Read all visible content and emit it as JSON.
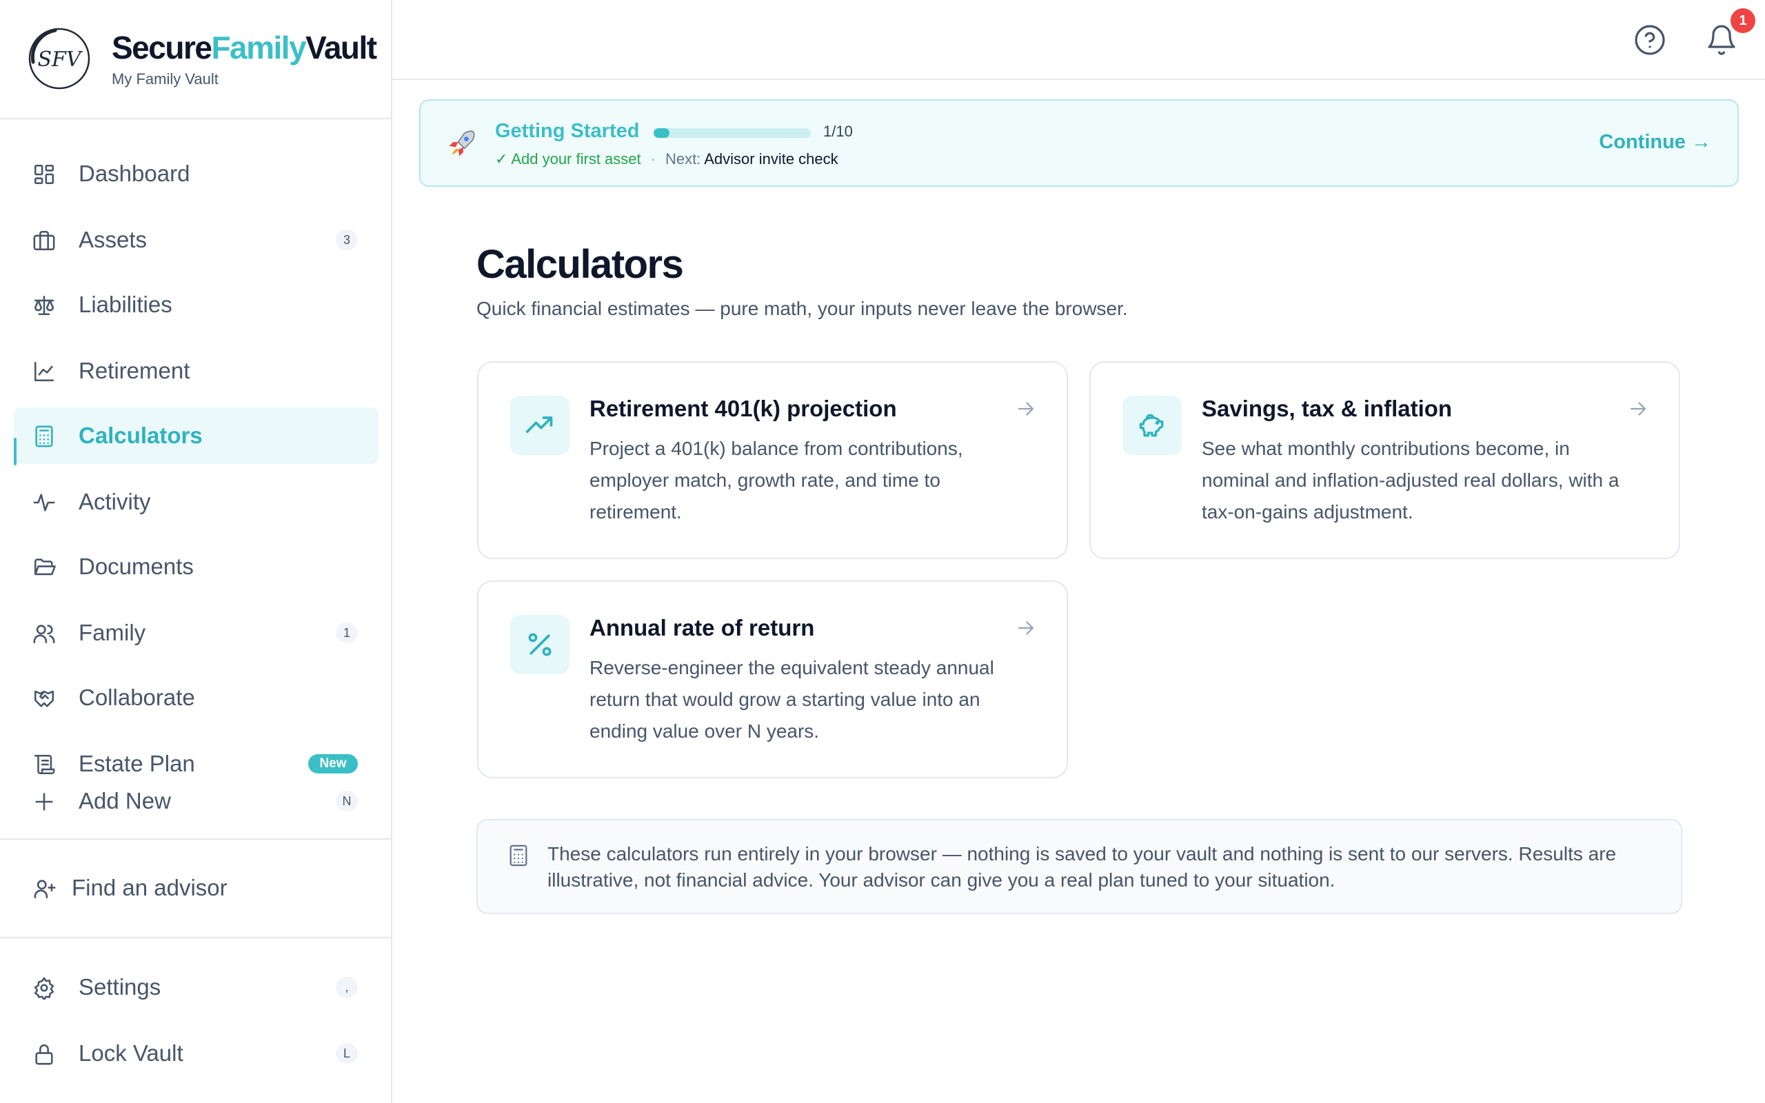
{
  "brand": {
    "logo_text": "SFV",
    "name_part1": "Secure",
    "name_part2": "Family",
    "name_part3": "Vault",
    "subtitle": "My Family Vault",
    "accent_color": "#3bbfc7"
  },
  "sidebar": {
    "items": [
      {
        "label": "Dashboard",
        "icon": "dashboard-icon"
      },
      {
        "label": "Assets",
        "icon": "briefcase-icon",
        "badge": "3"
      },
      {
        "label": "Liabilities",
        "icon": "scale-icon"
      },
      {
        "label": "Retirement",
        "icon": "line-chart-icon"
      },
      {
        "label": "Calculators",
        "icon": "calculator-icon",
        "active": true
      },
      {
        "label": "Activity",
        "icon": "activity-icon"
      },
      {
        "label": "Documents",
        "icon": "folder-open-icon"
      },
      {
        "label": "Family",
        "icon": "users-icon",
        "badge": "1"
      },
      {
        "label": "Collaborate",
        "icon": "handshake-icon"
      },
      {
        "label": "Estate Plan",
        "icon": "scroll-icon",
        "badge": "New"
      },
      {
        "label": "Add New",
        "icon": "plus-icon",
        "badge": "N"
      }
    ],
    "find_advisor": "Find an advisor",
    "settings": {
      "label": "Settings",
      "shortcut": ","
    },
    "lock": {
      "label": "Lock Vault",
      "shortcut": "L"
    }
  },
  "topbar": {
    "help_icon": "help-circle-icon",
    "bell_icon": "bell-icon",
    "notification_count": "1"
  },
  "getting_started": {
    "title": "Getting Started",
    "progress_text": "1/10",
    "progress_value": 0.1,
    "completed": "✓ Add your first asset",
    "next_label": "Next:",
    "next_value": "Advisor invite check",
    "continue_label": "Continue →"
  },
  "main": {
    "title": "Calculators",
    "subtitle": "Quick financial estimates — pure math, your inputs never leave the browser.",
    "cards": [
      {
        "title": "Retirement 401(k) projection",
        "description": "Project a 401(k) balance from contributions, employer match, growth rate, and time to retirement.",
        "icon": "trending-up-icon"
      },
      {
        "title": "Savings, tax & inflation",
        "description": "See what monthly contributions become, in nominal and inflation-adjusted real dollars, with a tax-on-gains adjustment.",
        "icon": "piggy-bank-icon"
      },
      {
        "title": "Annual rate of return",
        "description": "Reverse-engineer the equivalent steady annual return that would grow a starting value into an ending value over N years.",
        "icon": "percent-icon"
      }
    ],
    "note": "These calculators run entirely in your browser — nothing is saved to your vault and nothing is sent to our servers. Results are illustrative, not financial advice. Your advisor can give you a real plan tuned to your situation."
  }
}
